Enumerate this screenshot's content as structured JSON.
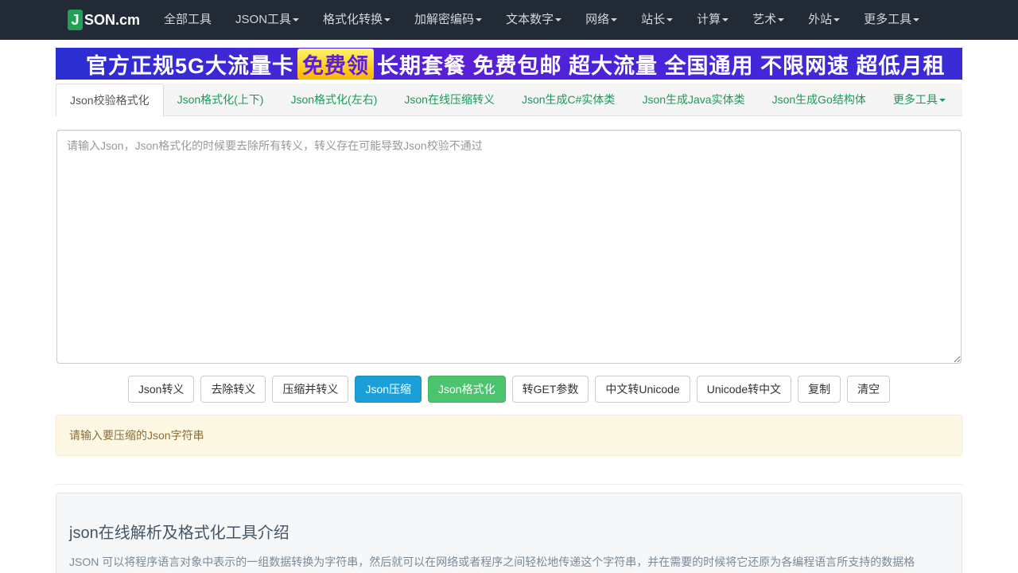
{
  "brand": {
    "j": "J",
    "rest": "SON.cm"
  },
  "nav": [
    {
      "label": "全部工具",
      "dropdown": false
    },
    {
      "label": "JSON工具",
      "dropdown": true
    },
    {
      "label": "格式化转换",
      "dropdown": true
    },
    {
      "label": "加解密编码",
      "dropdown": true
    },
    {
      "label": "文本数字",
      "dropdown": true
    },
    {
      "label": "网络",
      "dropdown": true
    },
    {
      "label": "站长",
      "dropdown": true
    },
    {
      "label": "计算",
      "dropdown": true
    },
    {
      "label": "艺术",
      "dropdown": true
    },
    {
      "label": "外站",
      "dropdown": true
    },
    {
      "label": "更多工具",
      "dropdown": true
    }
  ],
  "banner": {
    "part1": "官方正规5G大流量卡",
    "highlight": "免费领",
    "part2": "长期套餐 免费包邮 超大流量 全国通用 不限网速 超低月租"
  },
  "tabs": [
    {
      "label": "Json校验格式化",
      "active": true
    },
    {
      "label": "Json格式化(上下)",
      "active": false
    },
    {
      "label": "Json格式化(左右)",
      "active": false
    },
    {
      "label": "Json在线压缩转义",
      "active": false
    },
    {
      "label": "Json生成C#实体类",
      "active": false
    },
    {
      "label": "Json生成Java实体类",
      "active": false
    },
    {
      "label": "Json生成Go结构体",
      "active": false
    },
    {
      "label": "更多工具",
      "active": false,
      "dropdown": true
    }
  ],
  "input": {
    "value": "",
    "placeholder": "请输入Json，Json格式化的时候要去除所有转义，转义存在可能导致Json校验不通过"
  },
  "buttons": [
    {
      "label": "Json转义",
      "style": "default"
    },
    {
      "label": "去除转义",
      "style": "default"
    },
    {
      "label": "压缩并转义",
      "style": "default"
    },
    {
      "label": "Json压缩",
      "style": "primary"
    },
    {
      "label": "Json格式化",
      "style": "success"
    },
    {
      "label": "转GET参数",
      "style": "default"
    },
    {
      "label": "中文转Unicode",
      "style": "default"
    },
    {
      "label": "Unicode转中文",
      "style": "default"
    },
    {
      "label": "复制",
      "style": "default"
    },
    {
      "label": "清空",
      "style": "default"
    }
  ],
  "alert": {
    "text": "请输入要压缩的Json字符串"
  },
  "intro": {
    "title": "json在线解析及格式化工具介绍",
    "text": "JSON 可以将程序语言对象中表示的一组数据转换为字符串，然后就可以在网络或者程序之间轻松地传递这个字符串，并在需要的时候将它还原为各编程语言所支持的数据格式，例如在 PHP 中，可以将 JSON 还原为数组或者一个基本对象。在用到AJAX时，如果需要用到数组传值，这时就需要用JSON将数组转化为字符串。"
  },
  "colors": {
    "navbar": "#222a35",
    "brand_green": "#22a05a",
    "tab_link": "#1a9a5a",
    "primary": "#1b9fd8",
    "success": "#4cc46e",
    "alert_bg": "#fcf8e3",
    "alert_text": "#8a6d3b"
  }
}
